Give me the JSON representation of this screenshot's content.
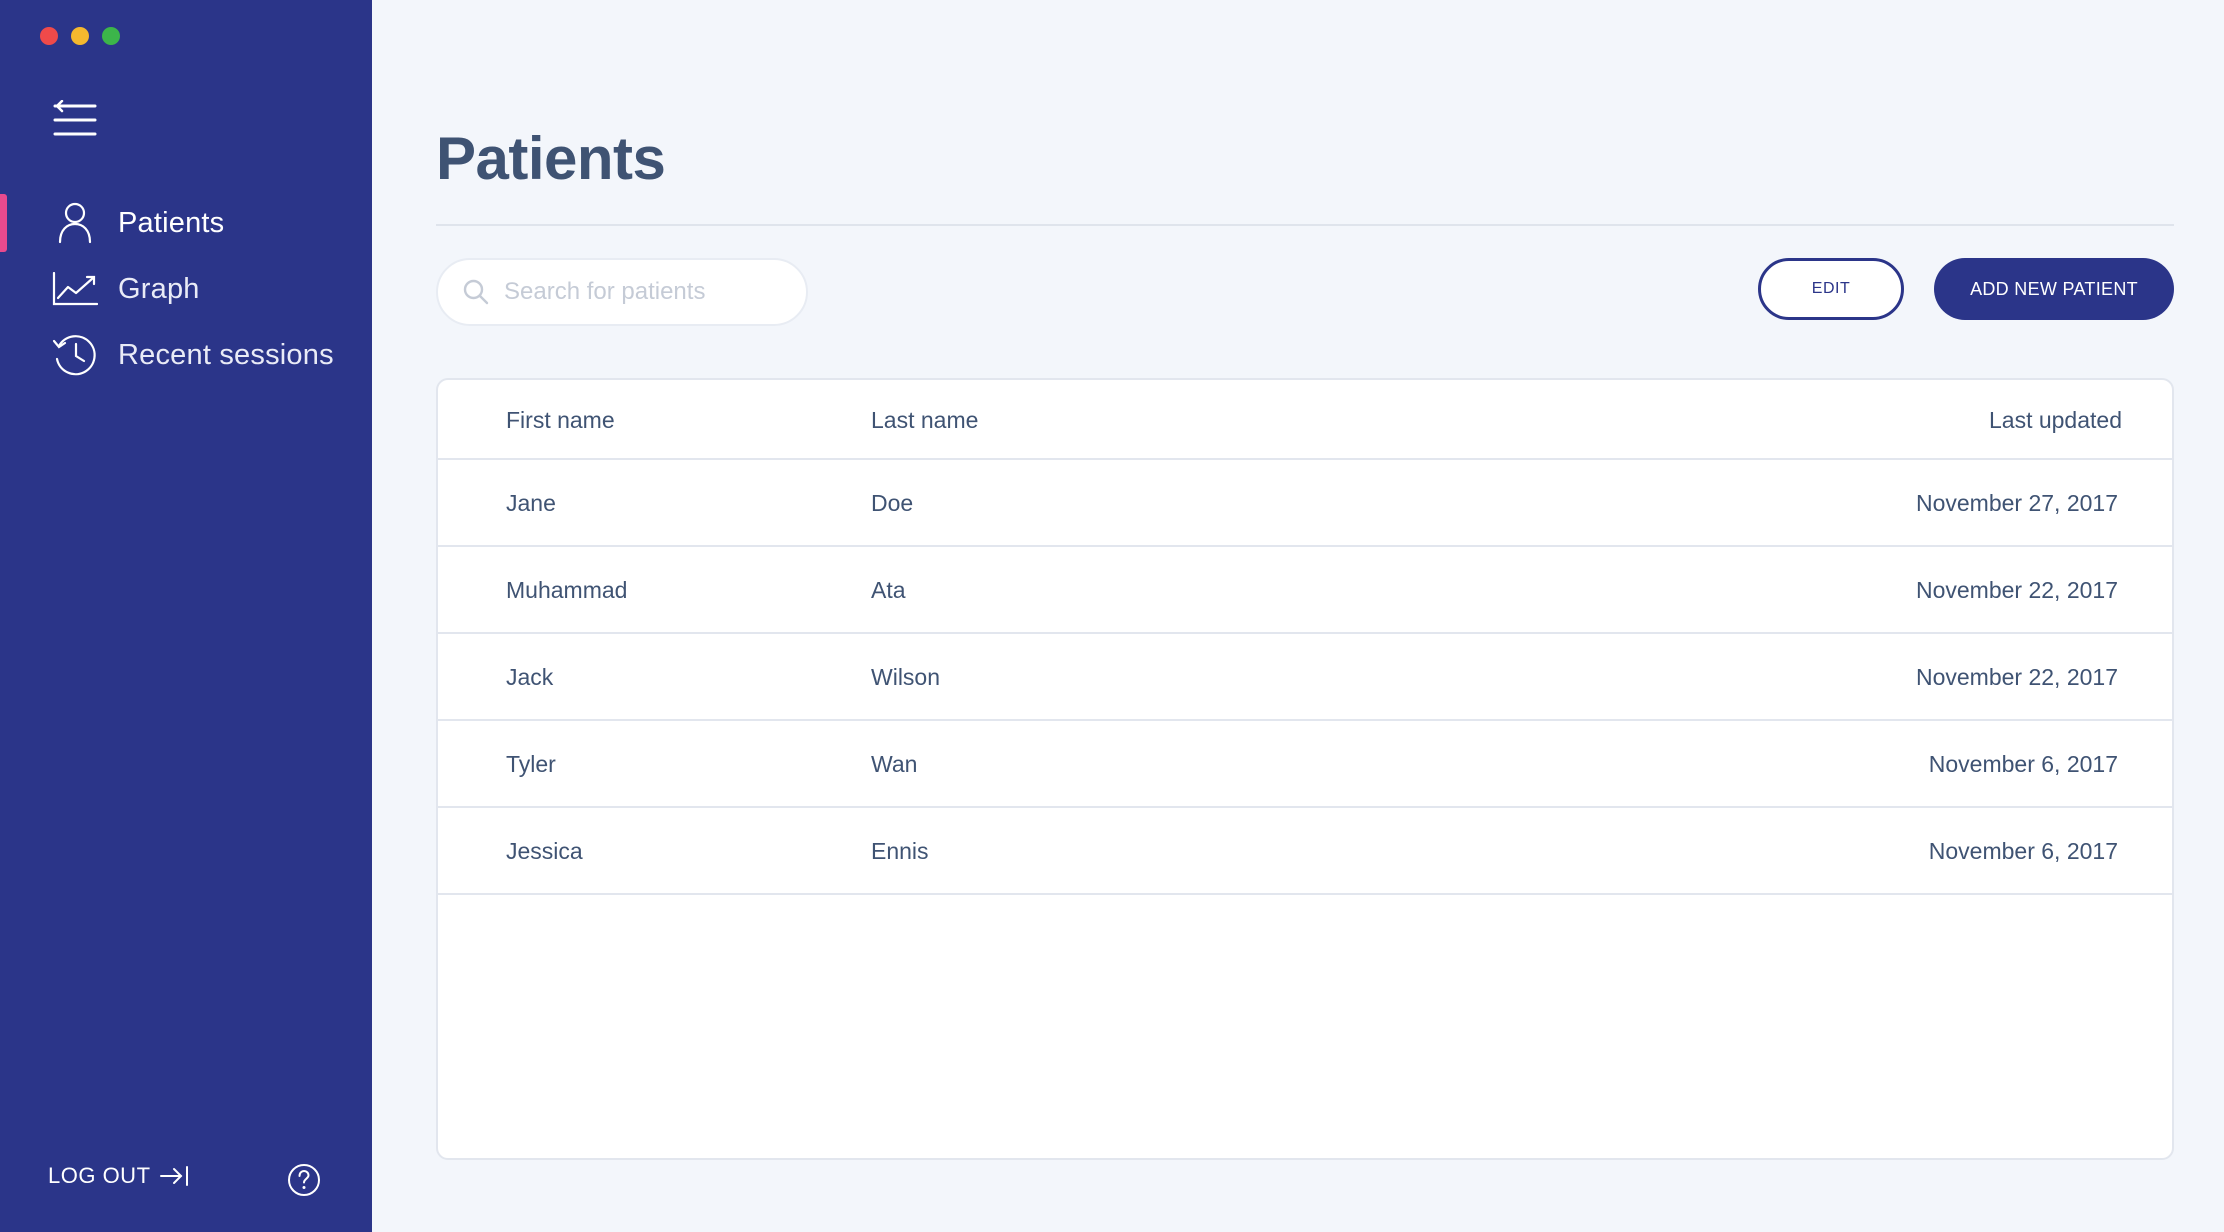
{
  "window": {
    "controls": [
      "close",
      "minimize",
      "maximize"
    ]
  },
  "sidebar": {
    "menu_icon": "hamburger-icon",
    "items": [
      {
        "label": "Patients",
        "icon": "user-icon",
        "active": true
      },
      {
        "label": "Graph",
        "icon": "line-chart-icon",
        "active": false
      },
      {
        "label": "Recent sessions",
        "icon": "history-icon",
        "active": false
      }
    ],
    "logout_label": "LOG OUT",
    "help_icon": "help-icon",
    "accent_color": "#e84a8e",
    "background_color": "#2b3589"
  },
  "main": {
    "title": "Patients",
    "search": {
      "placeholder": "Search for patients",
      "value": ""
    },
    "edit_label": "EDIT",
    "add_label": "ADD NEW PATIENT",
    "table": {
      "columns": [
        "First name",
        "Last name",
        "Last updated"
      ],
      "rows": [
        [
          "Jane",
          "Doe",
          "November 27, 2017"
        ],
        [
          "Muhammad",
          "Ata",
          "November 22, 2017"
        ],
        [
          "Jack",
          "Wilson",
          "November 22, 2017"
        ],
        [
          "Tyler",
          "Wan",
          "November 6, 2017"
        ],
        [
          "Jessica",
          "Ennis",
          "November 6, 2017"
        ]
      ]
    }
  }
}
